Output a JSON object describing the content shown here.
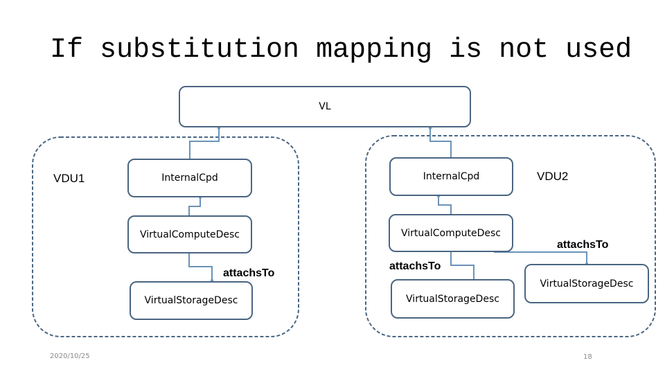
{
  "slide": {
    "title": "If substitution mapping is not used",
    "date": "2020/10/25",
    "page_number": "18"
  },
  "diagram": {
    "vl": {
      "label": "VL"
    },
    "vdu1": {
      "label": "VDU1",
      "internal_cpd": "InternalCpd",
      "virtual_compute_desc": "VirtualComputeDesc",
      "attachs_to": "attachsTo",
      "virtual_storage_desc": "VirtualStorageDesc"
    },
    "vdu2": {
      "label": "VDU2",
      "internal_cpd": "InternalCpd",
      "virtual_compute_desc": "VirtualComputeDesc",
      "attachs_to_1": "attachsTo",
      "virtual_storage_desc_1": "VirtualStorageDesc",
      "attachs_to_2": "attachsTo",
      "virtual_storage_desc_2": "VirtualStorageDesc"
    },
    "colors": {
      "box_border": "#4a6582",
      "connector": "#6a93b8",
      "group_border": "#4a6582"
    }
  }
}
